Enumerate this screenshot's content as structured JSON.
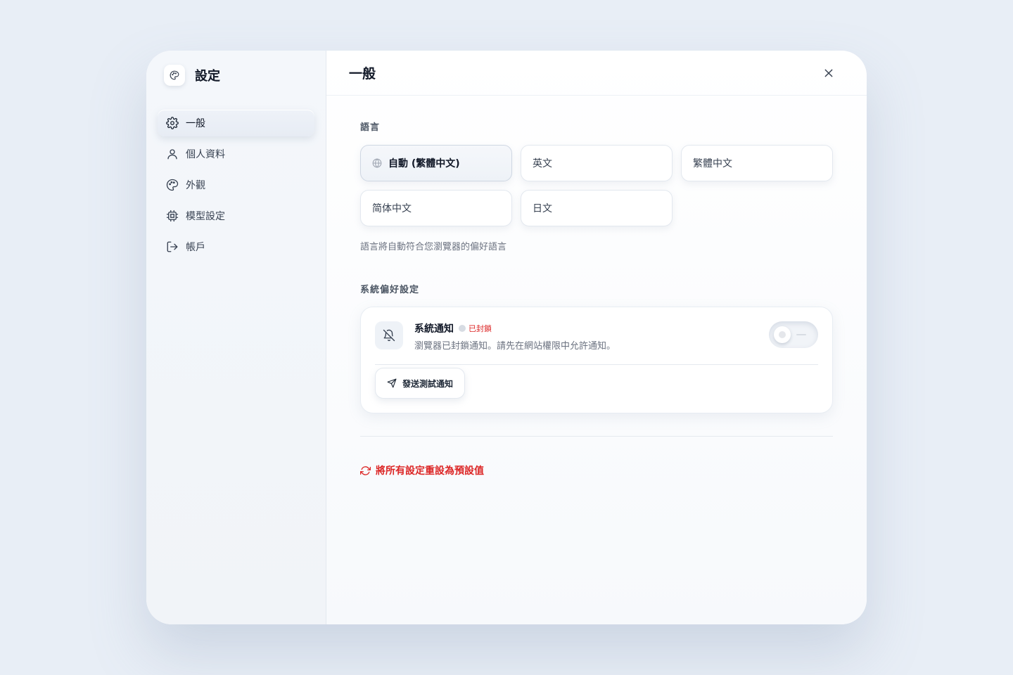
{
  "app": {
    "title": "設定",
    "icon": "palette-icon"
  },
  "sidebar": {
    "items": [
      {
        "label": "一般",
        "icon": "gear-icon",
        "active": true
      },
      {
        "label": "個人資料",
        "icon": "user-icon",
        "active": false
      },
      {
        "label": "外觀",
        "icon": "palette-icon",
        "active": false
      },
      {
        "label": "模型設定",
        "icon": "chip-icon",
        "active": false
      },
      {
        "label": "帳戶",
        "icon": "logout-icon",
        "active": false
      }
    ]
  },
  "main": {
    "title": "一般",
    "close_icon": "close-icon",
    "language": {
      "label": "語言",
      "options": [
        {
          "label": "自動 (繁體中文)",
          "selected": true,
          "icon": "globe-icon"
        },
        {
          "label": "英文",
          "selected": false
        },
        {
          "label": "繁體中文",
          "selected": false
        },
        {
          "label": "简体中文",
          "selected": false
        },
        {
          "label": "日文",
          "selected": false
        }
      ],
      "hint": "語言將自動符合您瀏覽器的偏好語言"
    },
    "system": {
      "label": "系統偏好設定",
      "notification": {
        "title": "系統通知",
        "status": "已封鎖",
        "description": "瀏覽器已封鎖通知。請先在網站權限中允許通知。",
        "enabled": false,
        "test_button": "發送測試通知"
      }
    },
    "reset_label": "將所有設定重設為預設值"
  },
  "colors": {
    "accent": "#111827",
    "danger": "#dc2626",
    "muted": "#6b7280"
  }
}
